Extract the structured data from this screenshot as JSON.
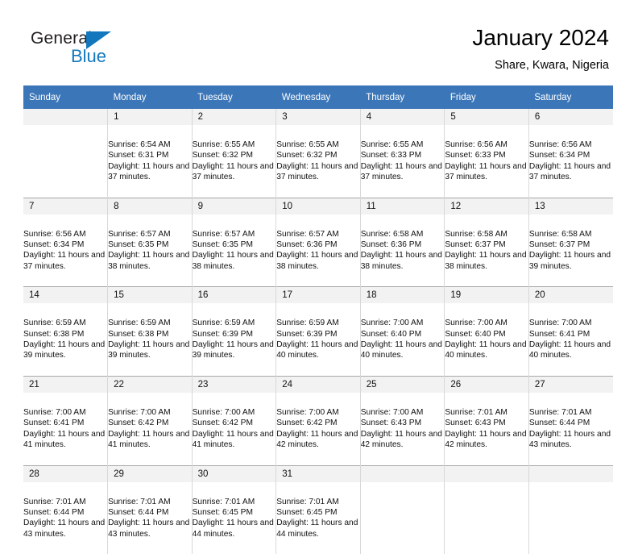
{
  "brand": {
    "name_top": "General",
    "name_bottom": "Blue",
    "accent_color": "#1277bc",
    "triangle_icon": "brand-triangle-icon"
  },
  "header": {
    "title": "January 2024",
    "subtitle": "Share, Kwara, Nigeria"
  },
  "calendar": {
    "header_bg": "#3b76b8",
    "daynum_bg": "#f2f2f2",
    "weekday_headers": [
      "Sunday",
      "Monday",
      "Tuesday",
      "Wednesday",
      "Thursday",
      "Friday",
      "Saturday"
    ],
    "labels": {
      "sunrise": "Sunrise:",
      "sunset": "Sunset:",
      "daylight": "Daylight:"
    },
    "weeks": [
      [
        {
          "day": ""
        },
        {
          "day": "1",
          "sunrise": "Sunrise: 6:54 AM",
          "sunset": "Sunset: 6:31 PM",
          "daylight": "Daylight: 11 hours and 37 minutes."
        },
        {
          "day": "2",
          "sunrise": "Sunrise: 6:55 AM",
          "sunset": "Sunset: 6:32 PM",
          "daylight": "Daylight: 11 hours and 37 minutes."
        },
        {
          "day": "3",
          "sunrise": "Sunrise: 6:55 AM",
          "sunset": "Sunset: 6:32 PM",
          "daylight": "Daylight: 11 hours and 37 minutes."
        },
        {
          "day": "4",
          "sunrise": "Sunrise: 6:55 AM",
          "sunset": "Sunset: 6:33 PM",
          "daylight": "Daylight: 11 hours and 37 minutes."
        },
        {
          "day": "5",
          "sunrise": "Sunrise: 6:56 AM",
          "sunset": "Sunset: 6:33 PM",
          "daylight": "Daylight: 11 hours and 37 minutes."
        },
        {
          "day": "6",
          "sunrise": "Sunrise: 6:56 AM",
          "sunset": "Sunset: 6:34 PM",
          "daylight": "Daylight: 11 hours and 37 minutes."
        }
      ],
      [
        {
          "day": "7",
          "sunrise": "Sunrise: 6:56 AM",
          "sunset": "Sunset: 6:34 PM",
          "daylight": "Daylight: 11 hours and 37 minutes."
        },
        {
          "day": "8",
          "sunrise": "Sunrise: 6:57 AM",
          "sunset": "Sunset: 6:35 PM",
          "daylight": "Daylight: 11 hours and 38 minutes."
        },
        {
          "day": "9",
          "sunrise": "Sunrise: 6:57 AM",
          "sunset": "Sunset: 6:35 PM",
          "daylight": "Daylight: 11 hours and 38 minutes."
        },
        {
          "day": "10",
          "sunrise": "Sunrise: 6:57 AM",
          "sunset": "Sunset: 6:36 PM",
          "daylight": "Daylight: 11 hours and 38 minutes."
        },
        {
          "day": "11",
          "sunrise": "Sunrise: 6:58 AM",
          "sunset": "Sunset: 6:36 PM",
          "daylight": "Daylight: 11 hours and 38 minutes."
        },
        {
          "day": "12",
          "sunrise": "Sunrise: 6:58 AM",
          "sunset": "Sunset: 6:37 PM",
          "daylight": "Daylight: 11 hours and 38 minutes."
        },
        {
          "day": "13",
          "sunrise": "Sunrise: 6:58 AM",
          "sunset": "Sunset: 6:37 PM",
          "daylight": "Daylight: 11 hours and 39 minutes."
        }
      ],
      [
        {
          "day": "14",
          "sunrise": "Sunrise: 6:59 AM",
          "sunset": "Sunset: 6:38 PM",
          "daylight": "Daylight: 11 hours and 39 minutes."
        },
        {
          "day": "15",
          "sunrise": "Sunrise: 6:59 AM",
          "sunset": "Sunset: 6:38 PM",
          "daylight": "Daylight: 11 hours and 39 minutes."
        },
        {
          "day": "16",
          "sunrise": "Sunrise: 6:59 AM",
          "sunset": "Sunset: 6:39 PM",
          "daylight": "Daylight: 11 hours and 39 minutes."
        },
        {
          "day": "17",
          "sunrise": "Sunrise: 6:59 AM",
          "sunset": "Sunset: 6:39 PM",
          "daylight": "Daylight: 11 hours and 40 minutes."
        },
        {
          "day": "18",
          "sunrise": "Sunrise: 7:00 AM",
          "sunset": "Sunset: 6:40 PM",
          "daylight": "Daylight: 11 hours and 40 minutes."
        },
        {
          "day": "19",
          "sunrise": "Sunrise: 7:00 AM",
          "sunset": "Sunset: 6:40 PM",
          "daylight": "Daylight: 11 hours and 40 minutes."
        },
        {
          "day": "20",
          "sunrise": "Sunrise: 7:00 AM",
          "sunset": "Sunset: 6:41 PM",
          "daylight": "Daylight: 11 hours and 40 minutes."
        }
      ],
      [
        {
          "day": "21",
          "sunrise": "Sunrise: 7:00 AM",
          "sunset": "Sunset: 6:41 PM",
          "daylight": "Daylight: 11 hours and 41 minutes."
        },
        {
          "day": "22",
          "sunrise": "Sunrise: 7:00 AM",
          "sunset": "Sunset: 6:42 PM",
          "daylight": "Daylight: 11 hours and 41 minutes."
        },
        {
          "day": "23",
          "sunrise": "Sunrise: 7:00 AM",
          "sunset": "Sunset: 6:42 PM",
          "daylight": "Daylight: 11 hours and 41 minutes."
        },
        {
          "day": "24",
          "sunrise": "Sunrise: 7:00 AM",
          "sunset": "Sunset: 6:42 PM",
          "daylight": "Daylight: 11 hours and 42 minutes."
        },
        {
          "day": "25",
          "sunrise": "Sunrise: 7:00 AM",
          "sunset": "Sunset: 6:43 PM",
          "daylight": "Daylight: 11 hours and 42 minutes."
        },
        {
          "day": "26",
          "sunrise": "Sunrise: 7:01 AM",
          "sunset": "Sunset: 6:43 PM",
          "daylight": "Daylight: 11 hours and 42 minutes."
        },
        {
          "day": "27",
          "sunrise": "Sunrise: 7:01 AM",
          "sunset": "Sunset: 6:44 PM",
          "daylight": "Daylight: 11 hours and 43 minutes."
        }
      ],
      [
        {
          "day": "28",
          "sunrise": "Sunrise: 7:01 AM",
          "sunset": "Sunset: 6:44 PM",
          "daylight": "Daylight: 11 hours and 43 minutes."
        },
        {
          "day": "29",
          "sunrise": "Sunrise: 7:01 AM",
          "sunset": "Sunset: 6:44 PM",
          "daylight": "Daylight: 11 hours and 43 minutes."
        },
        {
          "day": "30",
          "sunrise": "Sunrise: 7:01 AM",
          "sunset": "Sunset: 6:45 PM",
          "daylight": "Daylight: 11 hours and 44 minutes."
        },
        {
          "day": "31",
          "sunrise": "Sunrise: 7:01 AM",
          "sunset": "Sunset: 6:45 PM",
          "daylight": "Daylight: 11 hours and 44 minutes."
        },
        {
          "day": ""
        },
        {
          "day": ""
        },
        {
          "day": ""
        }
      ]
    ]
  }
}
